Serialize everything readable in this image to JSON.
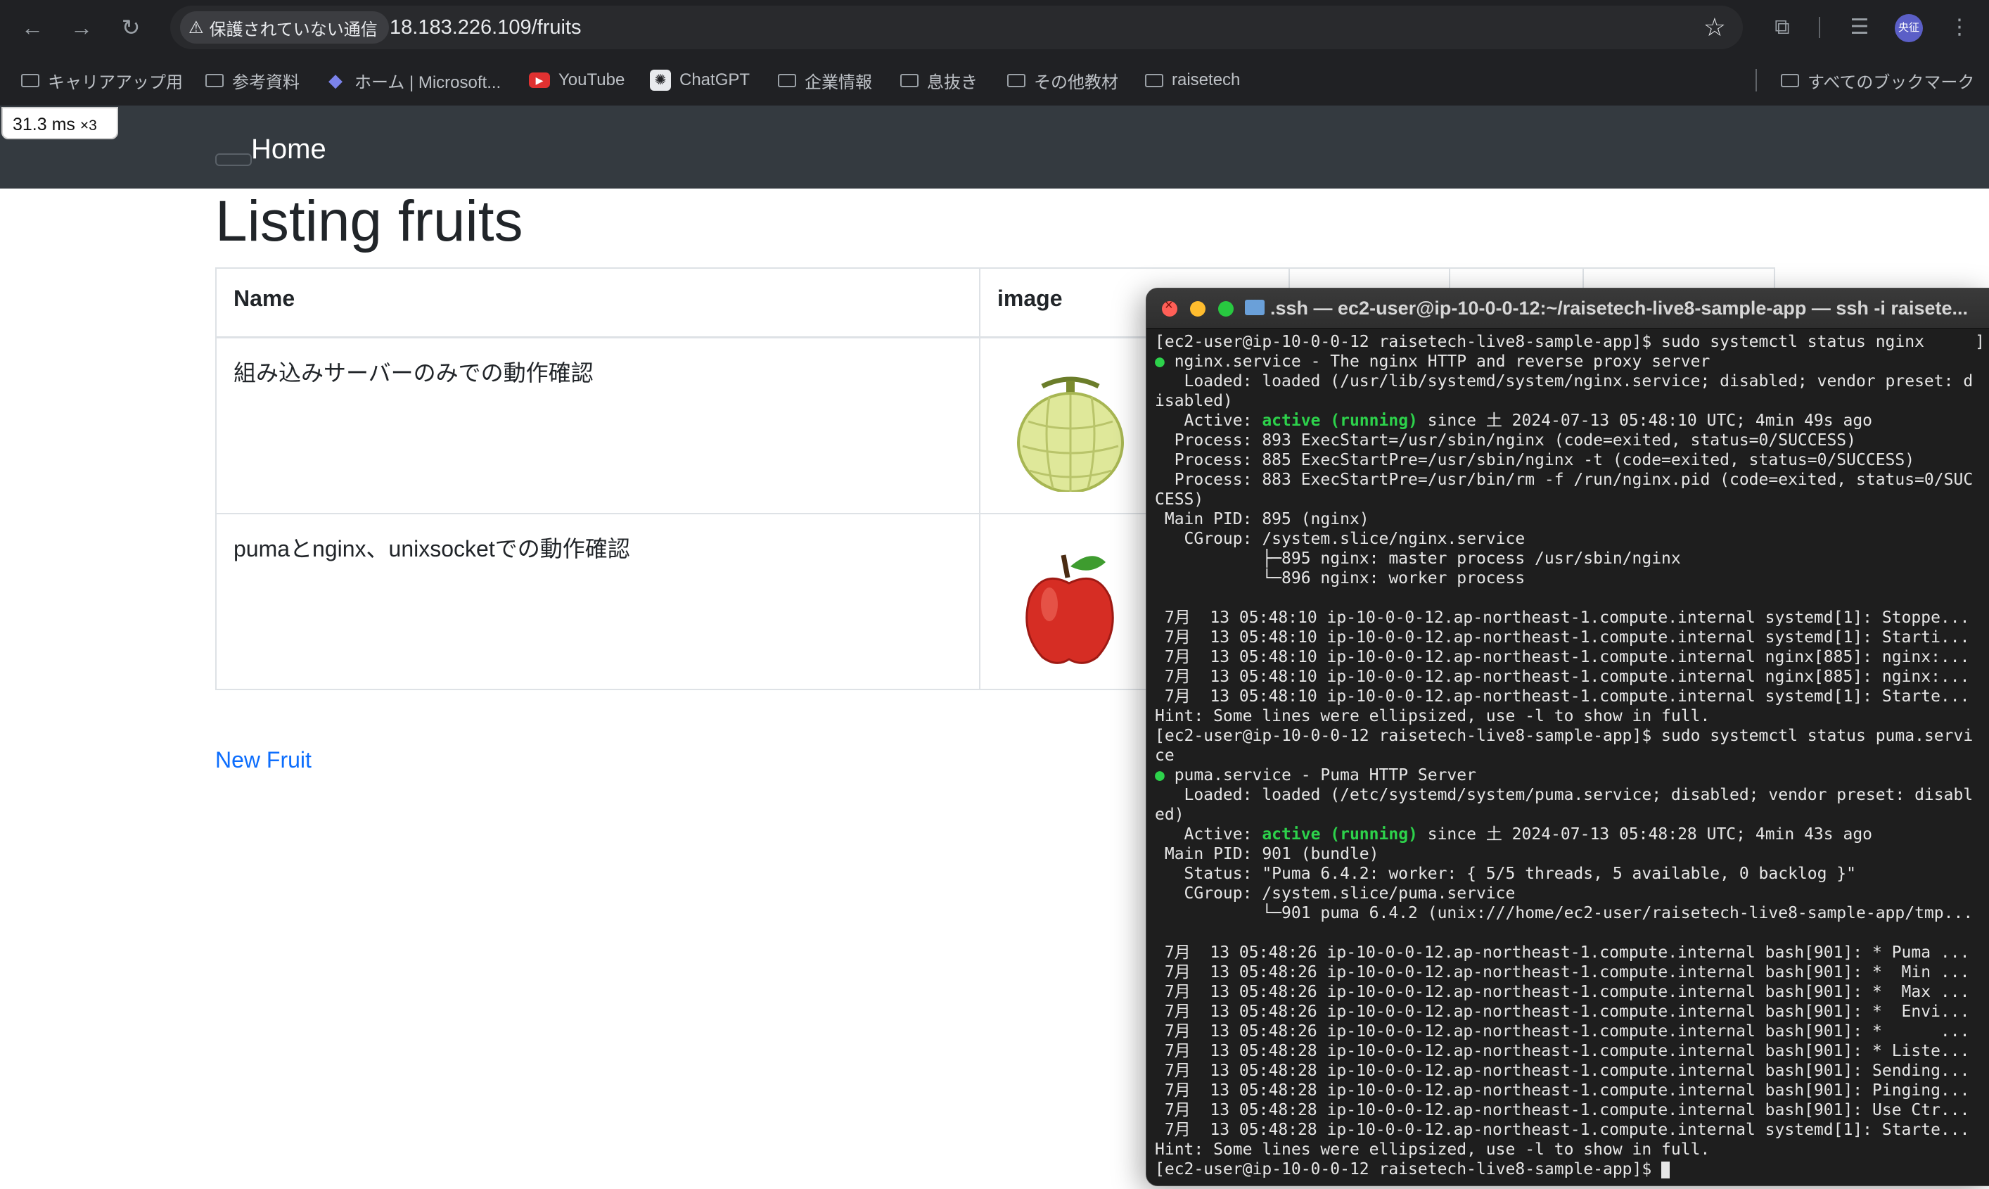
{
  "browser": {
    "nav": {
      "back": "←",
      "forward": "→",
      "reload": "↻"
    },
    "security_label": "保護されていない通信",
    "url": "18.183.226.109/fruits",
    "star": "☆",
    "toolbar_icons": {
      "extensions": "⧉",
      "reading_list": "☰",
      "more": "⋮"
    },
    "avatar_text": "央征",
    "bookmarks": [
      {
        "icon": "folder-icon",
        "label": "キャリアアップ用"
      },
      {
        "icon": "folder-icon",
        "label": "参考資料"
      },
      {
        "icon": "microsoft-icon",
        "label": "ホーム | Microsoft..."
      },
      {
        "icon": "youtube-icon",
        "label": "YouTube"
      },
      {
        "icon": "chatgpt-icon",
        "label": "ChatGPT"
      },
      {
        "icon": "folder-icon",
        "label": "企業情報"
      },
      {
        "icon": "folder-icon",
        "label": "息抜き"
      },
      {
        "icon": "folder-icon",
        "label": "その他教材"
      },
      {
        "icon": "folder-icon",
        "label": "raisetech"
      }
    ],
    "all_bookmarks": "すべてのブックマーク"
  },
  "perf_badge": {
    "value": "31.3 ms",
    "multiplier": "×3"
  },
  "page": {
    "brand": "Home",
    "title": "Listing fruits",
    "table": {
      "headers": [
        "Name",
        "image",
        "",
        "",
        ""
      ],
      "rows": [
        {
          "name": "組み込みサーバーのみでの動作確認",
          "image": "melon-image"
        },
        {
          "name": "pumaとnginx、unixsocketでの動作確認",
          "image": "apple-image"
        }
      ]
    },
    "new_link": "New Fruit"
  },
  "terminal": {
    "title": ".ssh — ec2-user@ip-10-0-0-12:~/raisetech-live8-sample-app — ssh -i raisete...",
    "right_bracket": "]",
    "lines": [
      "[ec2-user@ip-10-0-0-12 raisetech-live8-sample-app]$ sudo systemctl status nginx",
      "● nginx.service - The nginx HTTP and reverse proxy server",
      "   Loaded: loaded (/usr/lib/systemd/system/nginx.service; disabled; vendor preset: d",
      "isabled)",
      "   Active: active (running) since 土 2024-07-13 05:48:10 UTC; 4min 49s ago",
      "  Process: 893 ExecStart=/usr/sbin/nginx (code=exited, status=0/SUCCESS)",
      "  Process: 885 ExecStartPre=/usr/sbin/nginx -t (code=exited, status=0/SUCCESS)",
      "  Process: 883 ExecStartPre=/usr/bin/rm -f /run/nginx.pid (code=exited, status=0/SUC",
      "CESS)",
      " Main PID: 895 (nginx)",
      "   CGroup: /system.slice/nginx.service",
      "           ├─895 nginx: master process /usr/sbin/nginx",
      "           └─896 nginx: worker process",
      "",
      " 7月  13 05:48:10 ip-10-0-0-12.ap-northeast-1.compute.internal systemd[1]: Stoppe...",
      " 7月  13 05:48:10 ip-10-0-0-12.ap-northeast-1.compute.internal systemd[1]: Starti...",
      " 7月  13 05:48:10 ip-10-0-0-12.ap-northeast-1.compute.internal nginx[885]: nginx:...",
      " 7月  13 05:48:10 ip-10-0-0-12.ap-northeast-1.compute.internal nginx[885]: nginx:...",
      " 7月  13 05:48:10 ip-10-0-0-12.ap-northeast-1.compute.internal systemd[1]: Starte...",
      "Hint: Some lines were ellipsized, use -l to show in full.",
      "[ec2-user@ip-10-0-0-12 raisetech-live8-sample-app]$ sudo systemctl status puma.servi",
      "ce",
      "● puma.service - Puma HTTP Server",
      "   Loaded: loaded (/etc/systemd/system/puma.service; disabled; vendor preset: disabl",
      "ed)",
      "   Active: active (running) since 土 2024-07-13 05:48:28 UTC; 4min 43s ago",
      " Main PID: 901 (bundle)",
      "   Status: \"Puma 6.4.2: worker: { 5/5 threads, 5 available, 0 backlog }\"",
      "   CGroup: /system.slice/puma.service",
      "           └─901 puma 6.4.2 (unix:///home/ec2-user/raisetech-live8-sample-app/tmp...",
      "",
      " 7月  13 05:48:26 ip-10-0-0-12.ap-northeast-1.compute.internal bash[901]: * Puma ...",
      " 7月  13 05:48:26 ip-10-0-0-12.ap-northeast-1.compute.internal bash[901]: *  Min ...",
      " 7月  13 05:48:26 ip-10-0-0-12.ap-northeast-1.compute.internal bash[901]: *  Max ...",
      " 7月  13 05:48:26 ip-10-0-0-12.ap-northeast-1.compute.internal bash[901]: *  Envi...",
      " 7月  13 05:48:26 ip-10-0-0-12.ap-northeast-1.compute.internal bash[901]: *      ...",
      " 7月  13 05:48:28 ip-10-0-0-12.ap-northeast-1.compute.internal bash[901]: * Liste...",
      " 7月  13 05:48:28 ip-10-0-0-12.ap-northeast-1.compute.internal bash[901]: Sending...",
      " 7月  13 05:48:28 ip-10-0-0-12.ap-northeast-1.compute.internal bash[901]: Pinging...",
      " 7月  13 05:48:28 ip-10-0-0-12.ap-northeast-1.compute.internal bash[901]: Use Ctr...",
      " 7月  13 05:48:28 ip-10-0-0-12.ap-northeast-1.compute.internal systemd[1]: Starte...",
      "Hint: Some lines were ellipsized, use -l to show in full.",
      "[ec2-user@ip-10-0-0-12 raisetech-live8-sample-app]$ "
    ],
    "active_keyword": "active (running)",
    "status_dot": "●"
  },
  "colors": {
    "terminal_green": "#2dd24b",
    "link_blue": "#0d6efd",
    "navbar": "#343a40",
    "chrome_dark": "#202124"
  }
}
